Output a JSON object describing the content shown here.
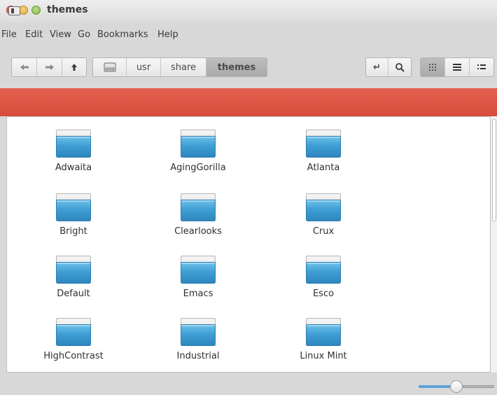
{
  "window": {
    "title": "themes"
  },
  "menu": [
    "File",
    "Edit",
    "View",
    "Go",
    "Bookmarks",
    "Help"
  ],
  "toolbar": {
    "nav_icons": [
      "back-arrow-icon",
      "forward-arrow-icon",
      "up-arrow-icon"
    ],
    "breadcrumb": {
      "root_icon": "drive-icon",
      "items": [
        "usr",
        "share",
        "themes"
      ],
      "active": "themes"
    },
    "action_icons": {
      "toggle_location": "↵",
      "search": "⌕"
    },
    "view_icons": {
      "icons": "⠿",
      "list": "≡",
      "compact": "⠶"
    },
    "active_view": "icons"
  },
  "files": [
    {
      "name": "Adwaita"
    },
    {
      "name": "AgingGorilla"
    },
    {
      "name": "Atlanta"
    },
    {
      "name": "Bright"
    },
    {
      "name": "Clearlooks"
    },
    {
      "name": "Crux"
    },
    {
      "name": "Default"
    },
    {
      "name": "Emacs"
    },
    {
      "name": "Esco"
    },
    {
      "name": "HighContrast"
    },
    {
      "name": "Industrial"
    },
    {
      "name": "Linux Mint"
    }
  ],
  "status": {
    "zoom_level": 0.5
  },
  "colors": {
    "accent_band": "#d84c3c",
    "folder_blue": "#3f9ed3",
    "zoom_fill": "#5fa2d6"
  }
}
